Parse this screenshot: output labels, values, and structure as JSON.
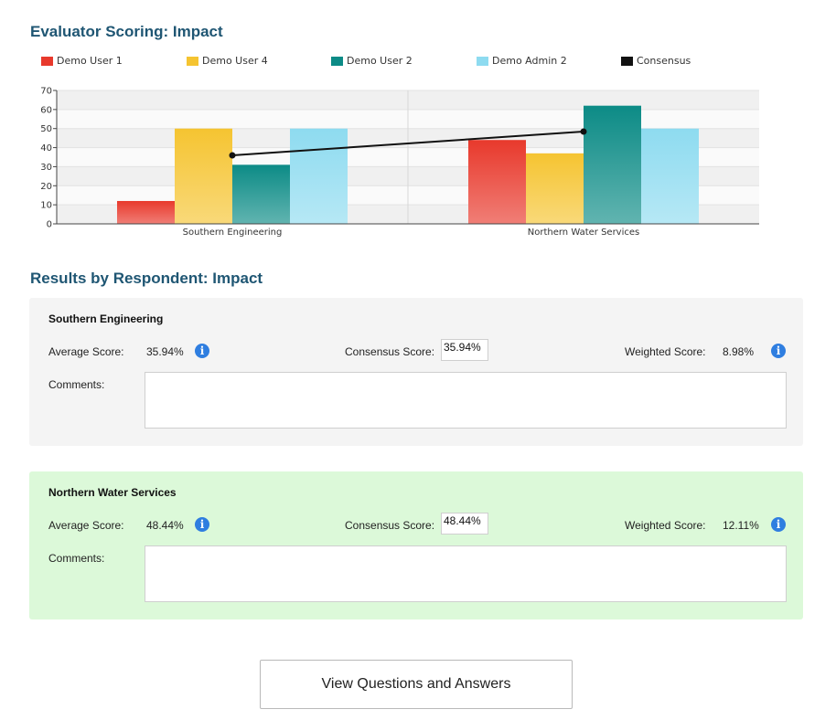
{
  "chart_section": {
    "title": "Evaluator Scoring: Impact"
  },
  "chart_data": {
    "type": "bar",
    "categories": [
      "Southern Engineering",
      "Northern Water Services"
    ],
    "series": [
      {
        "name": "Demo User 1",
        "values": [
          12,
          44
        ],
        "color": "#e8392c"
      },
      {
        "name": "Demo User 4",
        "values": [
          50,
          37
        ],
        "color": "#f5c431"
      },
      {
        "name": "Demo User 2",
        "values": [
          31,
          62
        ],
        "color": "#0c8b86"
      },
      {
        "name": "Demo Admin 2",
        "values": [
          50,
          50
        ],
        "color": "#8edbf0"
      }
    ],
    "line_series": {
      "name": "Consensus",
      "values": [
        35.94,
        48.44
      ],
      "color": "#111111"
    },
    "yticks": [
      "0",
      "10",
      "20",
      "30",
      "40",
      "50",
      "60",
      "70"
    ],
    "ylim": [
      0,
      70
    ],
    "grid": true,
    "legend": "top"
  },
  "results_section": {
    "title": "Results by Respondent: Impact"
  },
  "labels": {
    "average": "Average Score:",
    "consensus": "Consensus Score:",
    "weighted": "Weighted Score:",
    "comments": "Comments:"
  },
  "respondents": [
    {
      "name": "Southern Engineering",
      "average": "35.94%",
      "consensus": "35.94%",
      "weighted": "8.98%",
      "comments": ""
    },
    {
      "name": "Northern Water Services",
      "average": "48.44%",
      "consensus": "48.44%",
      "weighted": "12.11%",
      "comments": ""
    }
  ],
  "info_icon": "i",
  "view_button": {
    "label": "View Questions and Answers"
  }
}
